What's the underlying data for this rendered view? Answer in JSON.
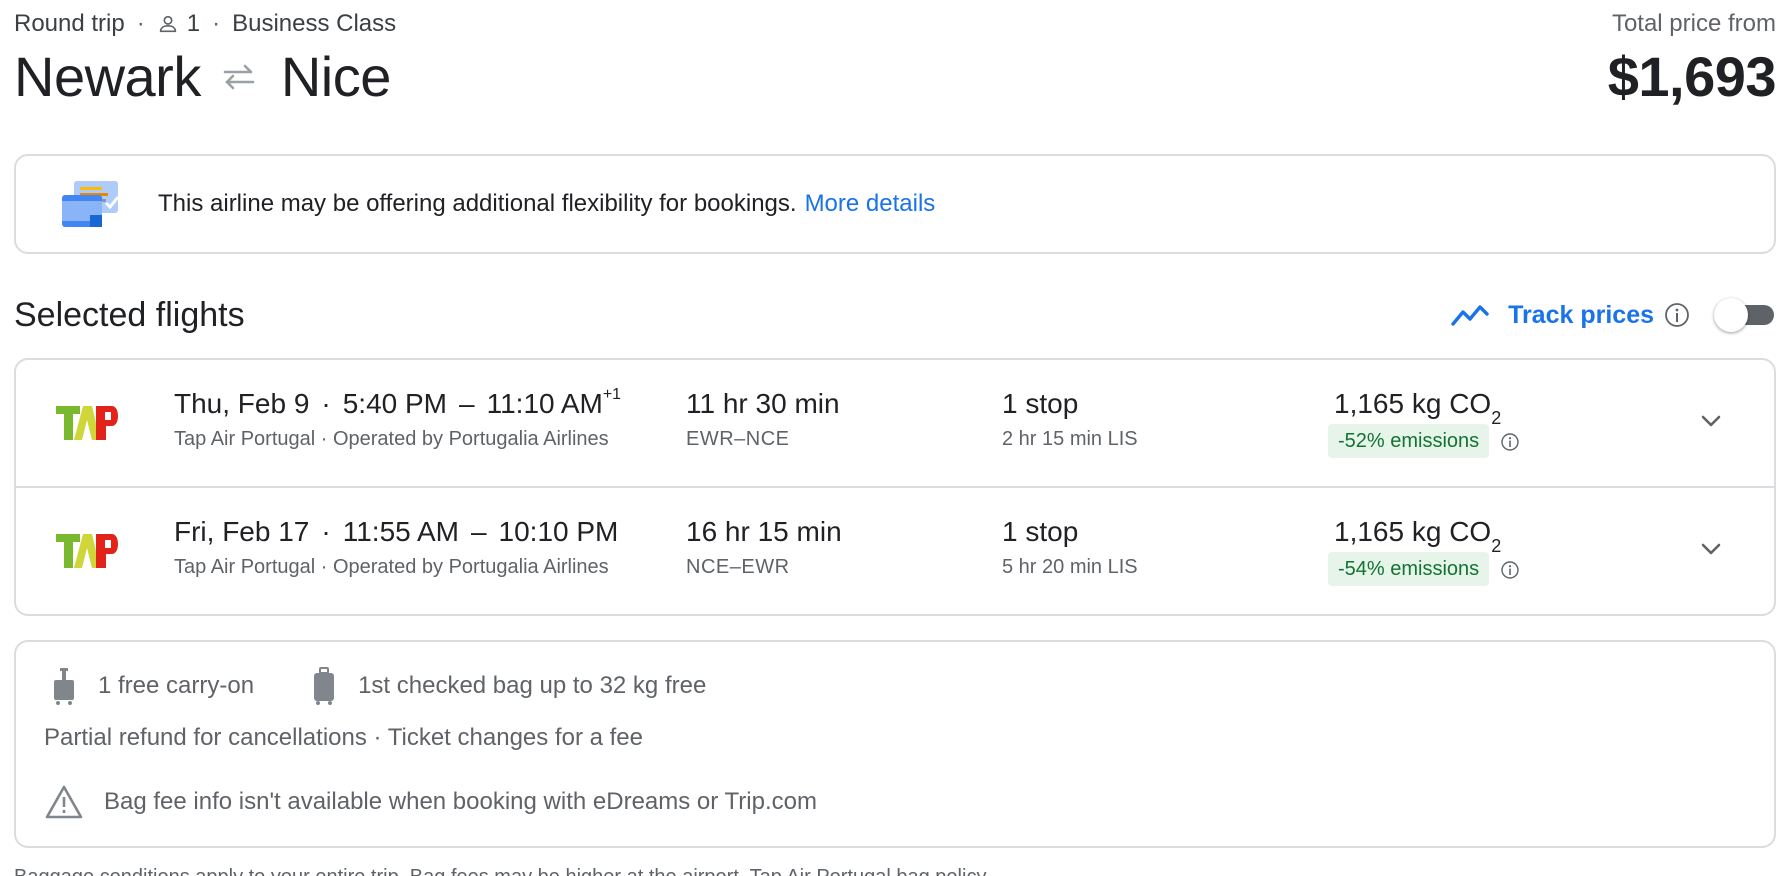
{
  "header": {
    "trip_type": "Round trip",
    "passengers": "1",
    "cabin": "Business Class",
    "origin": "Newark",
    "destination": "Nice",
    "price_label": "Total price from",
    "price": "$1,693"
  },
  "banner": {
    "text": "This airline may be offering additional flexibility for bookings.",
    "link": "More details"
  },
  "selected_flights": {
    "title": "Selected flights",
    "track_label": "Track prices",
    "track_enabled": false
  },
  "flights": [
    {
      "date": "Thu, Feb 9",
      "depart": "5:40 PM",
      "arrive": "11:10 AM",
      "day_offset": "+1",
      "airline": "Tap Air Portugal · Operated by Portugalia Airlines",
      "duration": "11 hr 30 min",
      "airports": "EWR–NCE",
      "stops": "1 stop",
      "layover": "2 hr 15 min LIS",
      "co2": "1,165 kg CO",
      "co2_sub": "2",
      "emissions": "-52% emissions"
    },
    {
      "date": "Fri, Feb 17",
      "depart": "11:55 AM",
      "arrive": "10:10 PM",
      "day_offset": "",
      "airline": "Tap Air Portugal · Operated by Portugalia Airlines",
      "duration": "16 hr 15 min",
      "airports": "NCE–EWR",
      "stops": "1 stop",
      "layover": "5 hr 20 min LIS",
      "co2": "1,165 kg CO",
      "co2_sub": "2",
      "emissions": "-54% emissions"
    }
  ],
  "baggage": {
    "carry_on": "1 free carry-on",
    "checked": "1st checked bag up to 32 kg free",
    "policy": "Partial refund for cancellations · Ticket changes for a fee",
    "warning": "Bag fee info isn't available when booking with eDreams or Trip.com"
  },
  "footnote": "Baggage conditions apply to your entire trip. Bag fees may be higher at the airport. Tap Air Portugal bag policy",
  "colors": {
    "accent": "#1a73e8",
    "emissions_bg": "#e6f4ea",
    "emissions_text": "#137333",
    "border": "#dadce0"
  }
}
